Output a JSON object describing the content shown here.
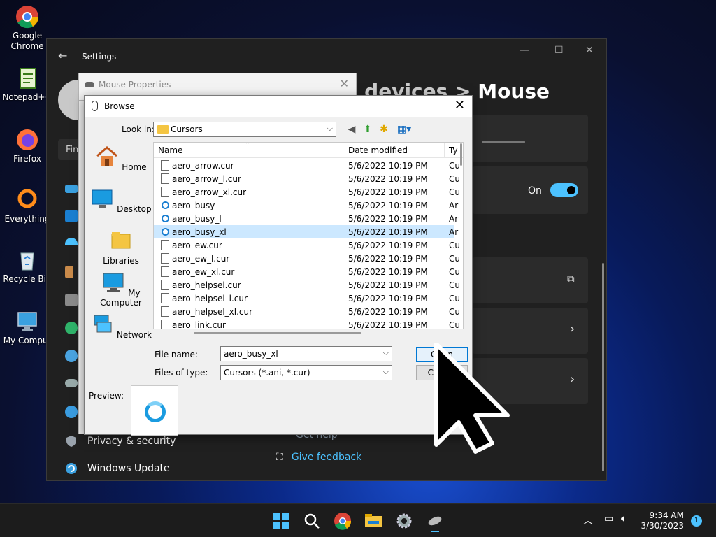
{
  "desktop": {
    "icons": [
      {
        "label": "Google Chrome"
      },
      {
        "label": "Notepad++"
      },
      {
        "label": "Firefox"
      },
      {
        "label": "Everything"
      },
      {
        "label": "Recycle Bin"
      },
      {
        "label": "My Comput"
      }
    ]
  },
  "settings": {
    "title": "Settings",
    "breadcrumb_dim": "& devices",
    "breadcrumb_sep": ">",
    "breadcrumb_current": "Mouse",
    "find_partial": "Fin",
    "toggle_label": "On",
    "nav": {
      "privacy": "Privacy & security",
      "update": "Windows Update"
    },
    "get_help": "Get help",
    "feedback": "Give feedback"
  },
  "mouse_props": {
    "title": "Mouse Properties"
  },
  "browse": {
    "title": "Browse",
    "look_in_label": "Look in:",
    "look_in_value": "Cursors",
    "places": [
      "Home",
      "Desktop",
      "Libraries",
      "My Computer",
      "Network"
    ],
    "columns": {
      "name": "Name",
      "date": "Date modified",
      "type": "Ty"
    },
    "files": [
      {
        "name": "aero_arrow.cur",
        "date": "5/6/2022 10:19 PM",
        "type": "Cu",
        "kind": "cur"
      },
      {
        "name": "aero_arrow_l.cur",
        "date": "5/6/2022 10:19 PM",
        "type": "Cu",
        "kind": "cur"
      },
      {
        "name": "aero_arrow_xl.cur",
        "date": "5/6/2022 10:19 PM",
        "type": "Cu",
        "kind": "cur"
      },
      {
        "name": "aero_busy",
        "date": "5/6/2022 10:19 PM",
        "type": "Ar",
        "kind": "ani"
      },
      {
        "name": "aero_busy_l",
        "date": "5/6/2022 10:19 PM",
        "type": "Ar",
        "kind": "ani"
      },
      {
        "name": "aero_busy_xl",
        "date": "5/6/2022 10:19 PM",
        "type": "Ar",
        "kind": "ani",
        "selected": true
      },
      {
        "name": "aero_ew.cur",
        "date": "5/6/2022 10:19 PM",
        "type": "Cu",
        "kind": "cur"
      },
      {
        "name": "aero_ew_l.cur",
        "date": "5/6/2022 10:19 PM",
        "type": "Cu",
        "kind": "cur"
      },
      {
        "name": "aero_ew_xl.cur",
        "date": "5/6/2022 10:19 PM",
        "type": "Cu",
        "kind": "cur"
      },
      {
        "name": "aero_helpsel.cur",
        "date": "5/6/2022 10:19 PM",
        "type": "Cu",
        "kind": "cur"
      },
      {
        "name": "aero_helpsel_l.cur",
        "date": "5/6/2022 10:19 PM",
        "type": "Cu",
        "kind": "cur"
      },
      {
        "name": "aero_helpsel_xl.cur",
        "date": "5/6/2022 10:19 PM",
        "type": "Cu",
        "kind": "cur"
      },
      {
        "name": "aero_link.cur",
        "date": "5/6/2022 10:19 PM",
        "type": "Cu",
        "kind": "cur"
      }
    ],
    "file_name_label": "File name:",
    "file_name_value": "aero_busy_xl",
    "files_of_type_label": "Files of type:",
    "files_of_type_value": "Cursors (*.ani, *.cur)",
    "open_button": "Open",
    "cancel_button": "Cancel",
    "preview_label": "Preview:"
  },
  "taskbar": {
    "time": "9:34 AM",
    "date": "3/30/2023",
    "notification_count": "1"
  },
  "colors": {
    "accent": "#4cc2ff",
    "selection": "#cce8ff",
    "settings_bg": "#202020"
  }
}
